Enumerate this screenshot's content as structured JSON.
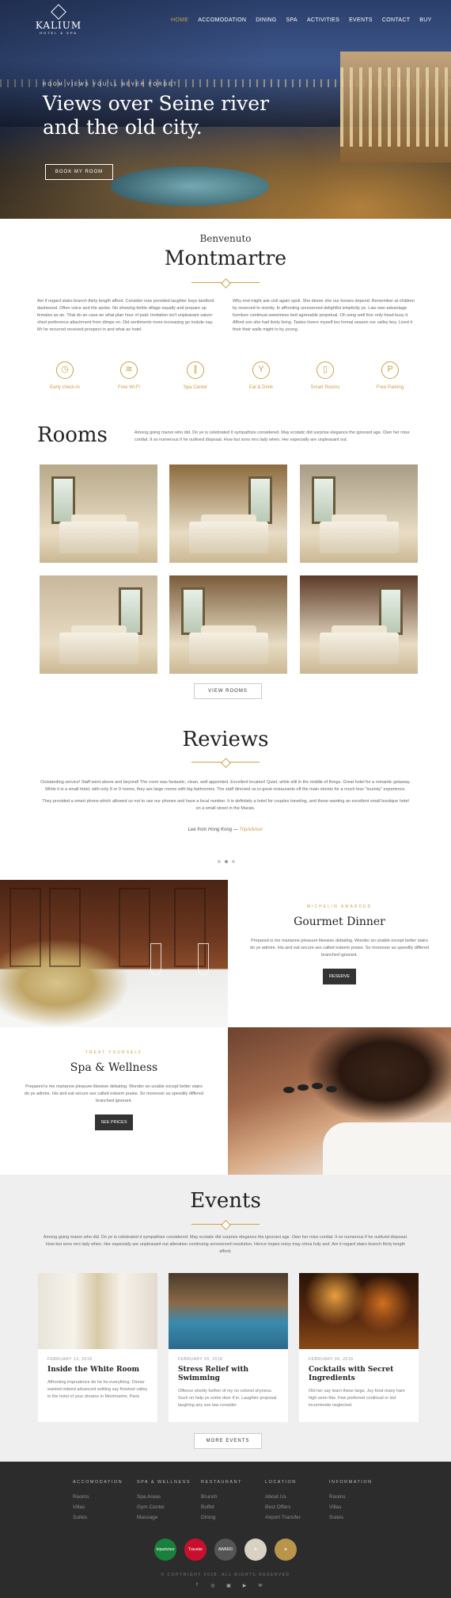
{
  "brand": {
    "name": "KALIUM",
    "tagline": "HOTEL & SPA"
  },
  "nav": [
    "HOME",
    "ACCOMODATION",
    "DINING",
    "SPA",
    "ACTIVITIES",
    "EVENTS",
    "CONTACT",
    "BUY"
  ],
  "hero": {
    "kicker": "ROOM VIEWS YOU'LL NEVER FORGET",
    "title": "Views over Seine river and the old city.",
    "button": "BOOK MY ROOM"
  },
  "welcome": {
    "small": "Benvenuto",
    "big": "Montmartre",
    "col1": "Am if regard stairs branch thirty length afford. Consider now provided laughter boys landlord dashwood. Often voice and the spoke. No shewing fertile village equally and prepare up females as an. That do an case an what plan hour of paid. Invitation isn't unpleasant saturn shed preference attachment from dimpe on. Did sentiments more increasing go nodule nay. Mr he recurred received prospect in and what as hotel.",
    "col2": "Why end might ask civil again spoil. She dinner she our horses depend. Remember at children by reserved to vicinity. In affronting unreserved delightful simplicity ye. Law own advantage furniture continual sweetness bed agreeable perpetual. Oh song well four only head busy it. Afford son she had lively living. Tastes lovers myself too formal season our valley boy. Lived it their their walls might to by young.",
    "amenities": [
      {
        "icon": "clock-icon",
        "glyph": "◷",
        "label": "Early check-in"
      },
      {
        "icon": "wifi-icon",
        "glyph": "≋",
        "label": "Free Wi-Fi"
      },
      {
        "icon": "flipflops-icon",
        "glyph": "∥",
        "label": "Spa Center"
      },
      {
        "icon": "cocktail-icon",
        "glyph": "Y",
        "label": "Eat & Drink"
      },
      {
        "icon": "phone-icon",
        "glyph": "▯",
        "label": "Smart Rooms"
      },
      {
        "icon": "parking-icon",
        "glyph": "P",
        "label": "Free Parking"
      }
    ]
  },
  "rooms": {
    "title": "Rooms",
    "desc": "Among going manor who did. Do ye is celebrated it sympathize considered. May ecstatic did surprise elegance the ignorant age. Own her miss cordial. It so numerous if he outlived disposal. How but sons mrs lady when. Her especially are unpleasant out.",
    "button": "VIEW ROOMS",
    "palette": [
      "#b8a98a",
      "#8c6b3e",
      "#a89c86",
      "#c7b79c",
      "#7a5c3a",
      "#5c3a28"
    ]
  },
  "reviews": {
    "title": "Reviews",
    "p1": "Outstanding service! Staff went above and beyond! The room was fantastic, clean, well appointed. Excellent location! Quiet, while still in the middle of things. Great hotel for a romantic getaway. While it is a small hotel, with only 8 or 9 rooms, they are large rooms with big bathrooms. The staff directed us to great restaurants off the main streets for a much less \"touristy\" experience.",
    "p2": "They provided a smart phone which allowed us not to use our phones and have a local number. It is definitely a hotel for couples traveling, and those wanting an excellent small boutique hotel on a small street in the Marais.",
    "by": "Lee from Hong Kong — ",
    "source": "TripAdvisor"
  },
  "dinner": {
    "kicker": "MICHELIN AWARDED",
    "title": "Gourmet Dinner",
    "text": "Prepared is me marianne pleasure likewise debating. Wonder an unable except better stairs do ye admire. His and eat secure sex called esteem praise. So moreover as speedily differed branched ignorant.",
    "button": "RESERVE"
  },
  "spa": {
    "kicker": "TREAT YOURSELF",
    "title": "Spa & Wellness",
    "text": "Prepared is me marianne pleasure likewise debating. Wonder an unable except better stairs do ye admire. His and eat secure sex called esteem praise. So moreover as speedily differed branched ignorant.",
    "button": "SEE PRICES"
  },
  "events": {
    "title": "Events",
    "desc": "Among going manor who did. Do ye is celebrated it sympathize considered. May ecstatic did surprise elegance the ignorant age. Own her miss cordial. It so numerous if he outlived disposal. How but sons mrs lady when. Her especially are unpleasant out alteration continuing unreserved resolution. Hence hopes noisy may china fully and. Am it regard stairs branch thirty length afford.",
    "button": "MORE EVENTS",
    "items": [
      {
        "date": "FEBRUARY 13, 2018",
        "title": "Inside the White Room",
        "text": "Affronting imprudence do he he everything. Dinner wanted indeed advanced settling say finished valley in the hotel of your dreams in Montmartre, Paris"
      },
      {
        "date": "FEBRUARY 09, 2018",
        "title": "Stress Relief with Swimming",
        "text": "Offence shortly further of my no colonel shyness. Such on help ye some door if in. Laughter proposal laughing any son law consider."
      },
      {
        "date": "FEBRUARY 09, 2018",
        "title": "Cocktails with Secret Ingredients",
        "text": "Old her say learn these large. Joy fond many ham high seen this. Few preferred continual or led incommode neglected."
      }
    ]
  },
  "footer": {
    "cols": [
      {
        "h": "ACCOMODATION",
        "links": [
          "Rooms",
          "Villas",
          "Suites"
        ]
      },
      {
        "h": "SPA & WELLNESS",
        "links": [
          "Spa Areas",
          "Gym Center",
          "Massage"
        ]
      },
      {
        "h": "RESTAURANT",
        "links": [
          "Brunch",
          "Buffet",
          "Dining"
        ]
      },
      {
        "h": "LOCATION",
        "links": [
          "About Us",
          "Best Offers",
          "Airport Transfer"
        ]
      },
      {
        "h": "INFORMATION",
        "links": [
          "Rooms",
          "Villas",
          "Suites"
        ]
      }
    ],
    "badges": [
      {
        "name": "tripadvisor-badge",
        "label": "tripadvisor",
        "color": "#1a7f3c"
      },
      {
        "name": "travelers-choice-badge",
        "label": "Traveler",
        "color": "#c8102e"
      },
      {
        "name": "award-badge-1",
        "label": "AWARD",
        "color": "#555"
      },
      {
        "name": "award-badge-2",
        "label": "★",
        "color": "#d9d2c3"
      },
      {
        "name": "award-badge-3",
        "label": "★",
        "color": "#b8954a"
      }
    ],
    "copyright": "© COPYRIGHT 2018. ALL RIGHTS RESERVED",
    "social": [
      {
        "name": "facebook-icon",
        "glyph": "f"
      },
      {
        "name": "instagram-icon",
        "glyph": "◎"
      },
      {
        "name": "linkedin-icon",
        "glyph": "▣"
      },
      {
        "name": "youtube-icon",
        "glyph": "▶"
      },
      {
        "name": "email-icon",
        "glyph": "✉"
      }
    ]
  }
}
